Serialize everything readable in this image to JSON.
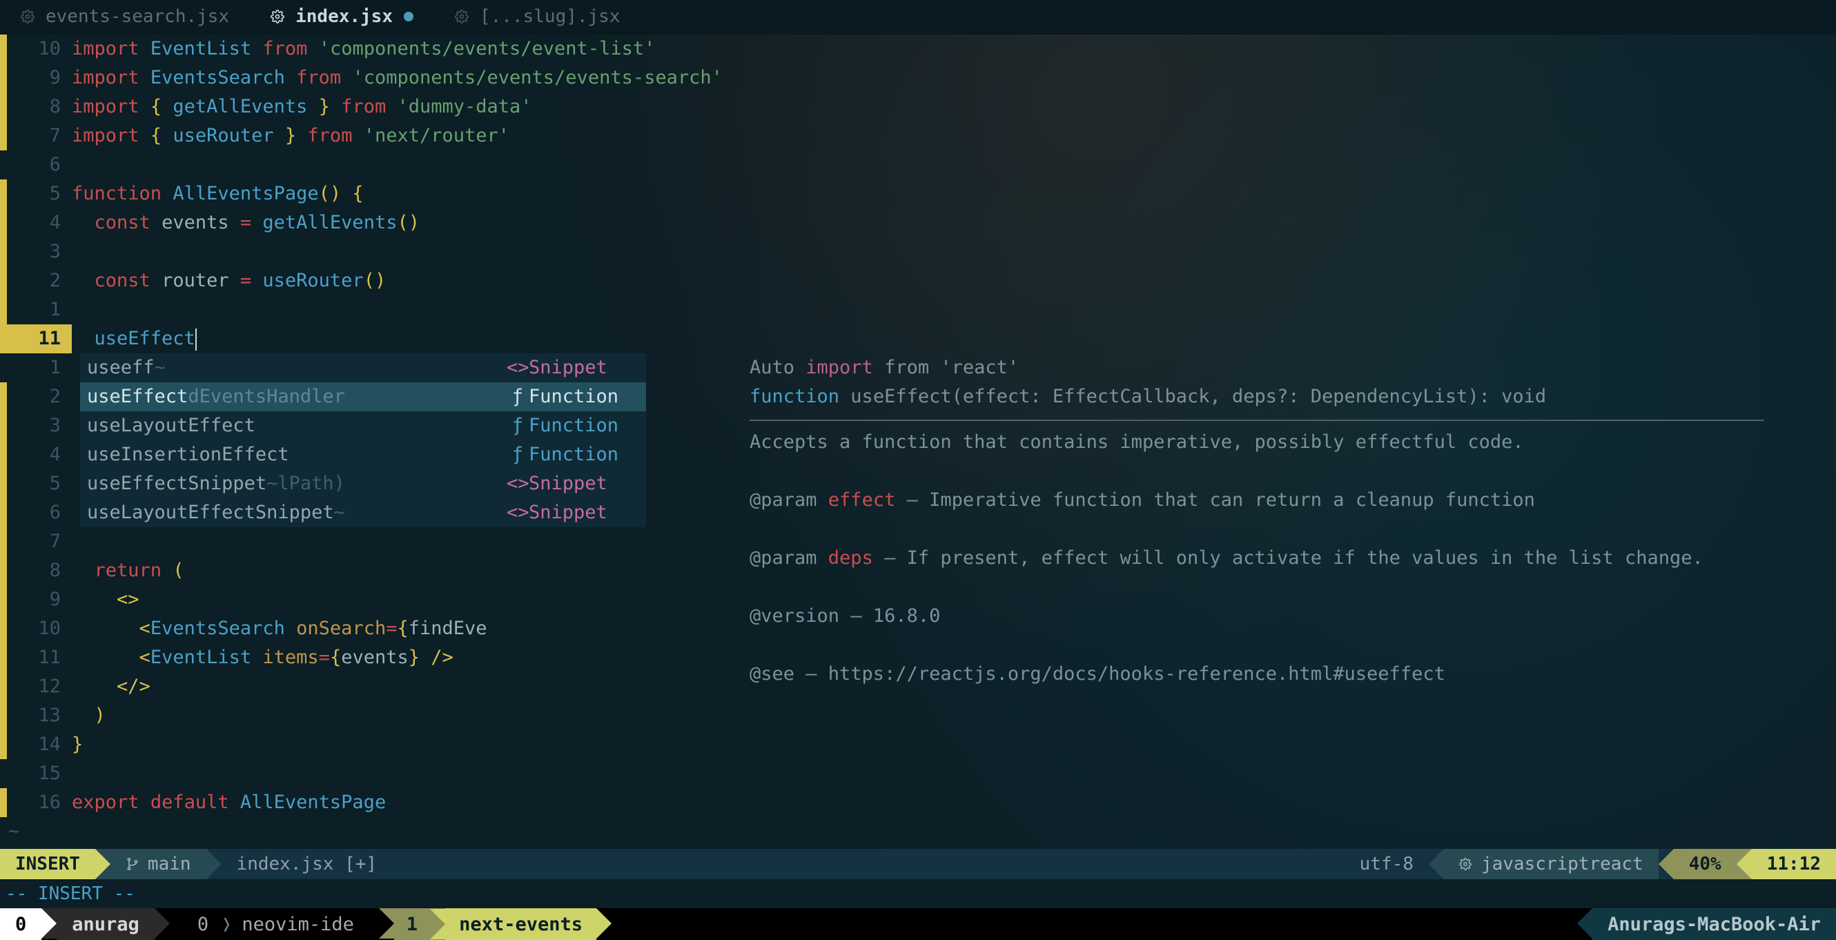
{
  "tabs": [
    {
      "name": "events-search.jsx",
      "active": false,
      "modified": false
    },
    {
      "name": "index.jsx",
      "active": true,
      "modified": true
    },
    {
      "name": "[...slug].jsx",
      "active": false,
      "modified": false
    }
  ],
  "code": {
    "lines": [
      {
        "n": "10",
        "rel": true,
        "border": true,
        "tokens": [
          [
            "kw",
            "import"
          ],
          [
            "pl",
            " "
          ],
          [
            "ident",
            "EventList"
          ],
          [
            "pl",
            " "
          ],
          [
            "kw",
            "from"
          ],
          [
            "pl",
            " "
          ],
          [
            "str",
            "'components/events/event-list'"
          ]
        ]
      },
      {
        "n": "9",
        "rel": true,
        "border": true,
        "tokens": [
          [
            "kw",
            "import"
          ],
          [
            "pl",
            " "
          ],
          [
            "ident",
            "EventsSearch"
          ],
          [
            "pl",
            " "
          ],
          [
            "kw",
            "from"
          ],
          [
            "pl",
            " "
          ],
          [
            "str",
            "'components/events/events-search'"
          ]
        ]
      },
      {
        "n": "8",
        "rel": true,
        "border": true,
        "tokens": [
          [
            "kw",
            "import"
          ],
          [
            "pl",
            " "
          ],
          [
            "brace",
            "{ "
          ],
          [
            "ident",
            "getAllEvents"
          ],
          [
            "brace",
            " }"
          ],
          [
            "pl",
            " "
          ],
          [
            "kw",
            "from"
          ],
          [
            "pl",
            " "
          ],
          [
            "str",
            "'dummy-data'"
          ]
        ]
      },
      {
        "n": "7",
        "rel": true,
        "border": true,
        "tokens": [
          [
            "kw",
            "import"
          ],
          [
            "pl",
            " "
          ],
          [
            "brace",
            "{ "
          ],
          [
            "ident",
            "useRouter"
          ],
          [
            "brace",
            " }"
          ],
          [
            "pl",
            " "
          ],
          [
            "kw",
            "from"
          ],
          [
            "pl",
            " "
          ],
          [
            "str",
            "'next/router'"
          ]
        ]
      },
      {
        "n": "6",
        "rel": true,
        "border": false,
        "tokens": []
      },
      {
        "n": "5",
        "rel": true,
        "border": true,
        "tokens": [
          [
            "kw",
            "function"
          ],
          [
            "pl",
            " "
          ],
          [
            "ident",
            "AllEventsPage"
          ],
          [
            "brace",
            "()"
          ],
          [
            "pl",
            " "
          ],
          [
            "brace",
            "{"
          ]
        ]
      },
      {
        "n": "4",
        "rel": true,
        "border": true,
        "tokens": [
          [
            "pl",
            "  "
          ],
          [
            "kw",
            "const"
          ],
          [
            "pl",
            " "
          ],
          [
            "pl",
            "events "
          ],
          [
            "kw",
            "="
          ],
          [
            "pl",
            " "
          ],
          [
            "ident",
            "getAllEvents"
          ],
          [
            "brace",
            "()"
          ]
        ]
      },
      {
        "n": "3",
        "rel": true,
        "border": true,
        "tokens": []
      },
      {
        "n": "2",
        "rel": true,
        "border": true,
        "tokens": [
          [
            "pl",
            "  "
          ],
          [
            "kw",
            "const"
          ],
          [
            "pl",
            " "
          ],
          [
            "pl",
            "router "
          ],
          [
            "kw",
            "="
          ],
          [
            "pl",
            " "
          ],
          [
            "ident",
            "useRouter"
          ],
          [
            "brace",
            "()"
          ]
        ]
      },
      {
        "n": "1",
        "rel": true,
        "border": true,
        "tokens": []
      },
      {
        "n": "11",
        "rel": false,
        "border": true,
        "current": true,
        "tokens": [
          [
            "pl",
            "  "
          ],
          [
            "ident",
            "useEffect"
          ]
        ],
        "cursor": true
      },
      {
        "n": "1",
        "rel": true,
        "border": false,
        "completion_row": true
      },
      {
        "n": "2",
        "rel": true,
        "border": true,
        "completion_row": true
      },
      {
        "n": "3",
        "rel": true,
        "border": true,
        "completion_row": true
      },
      {
        "n": "4",
        "rel": true,
        "border": true,
        "completion_row": true
      },
      {
        "n": "5",
        "rel": true,
        "border": true,
        "completion_row": true
      },
      {
        "n": "6",
        "rel": true,
        "border": true,
        "completion_row": true
      },
      {
        "n": "7",
        "rel": true,
        "border": true,
        "tokens": []
      },
      {
        "n": "8",
        "rel": true,
        "border": true,
        "tokens": [
          [
            "pl",
            "  "
          ],
          [
            "kw",
            "return"
          ],
          [
            "pl",
            " "
          ],
          [
            "brace",
            "("
          ]
        ]
      },
      {
        "n": "9",
        "rel": true,
        "border": true,
        "tokens": [
          [
            "pl",
            "    "
          ],
          [
            "brace",
            "<>"
          ]
        ]
      },
      {
        "n": "10",
        "rel": true,
        "border": true,
        "tokens": [
          [
            "pl",
            "      "
          ],
          [
            "brace",
            "<"
          ],
          [
            "ident",
            "EventsSearch"
          ],
          [
            "pl",
            " "
          ],
          [
            "propk",
            "onSearch"
          ],
          [
            "kw",
            "="
          ],
          [
            "brace",
            "{"
          ],
          [
            "pl",
            "findEve"
          ]
        ]
      },
      {
        "n": "11",
        "rel": true,
        "border": true,
        "tokens": [
          [
            "pl",
            "      "
          ],
          [
            "brace",
            "<"
          ],
          [
            "ident",
            "EventList"
          ],
          [
            "pl",
            " "
          ],
          [
            "propk",
            "items"
          ],
          [
            "kw",
            "="
          ],
          [
            "brace",
            "{"
          ],
          [
            "pl",
            "events"
          ],
          [
            "brace",
            "}"
          ],
          [
            "pl",
            " "
          ],
          [
            "brace",
            "/>"
          ]
        ]
      },
      {
        "n": "12",
        "rel": true,
        "border": true,
        "tokens": [
          [
            "pl",
            "    "
          ],
          [
            "brace",
            "</>"
          ]
        ]
      },
      {
        "n": "13",
        "rel": true,
        "border": true,
        "tokens": [
          [
            "pl",
            "  "
          ],
          [
            "brace",
            ")"
          ]
        ]
      },
      {
        "n": "14",
        "rel": true,
        "border": true,
        "tokens": [
          [
            "brace",
            "}"
          ]
        ]
      },
      {
        "n": "15",
        "rel": true,
        "border": false,
        "tokens": []
      },
      {
        "n": "16",
        "rel": true,
        "border": true,
        "tokens": [
          [
            "kw",
            "export"
          ],
          [
            "pl",
            " "
          ],
          [
            "kw",
            "default"
          ],
          [
            "pl",
            " "
          ],
          [
            "ident",
            "AllEventsPage"
          ]
        ]
      }
    ],
    "end_tilde": "~"
  },
  "completion": {
    "items": [
      {
        "label": "useeff",
        "tilde": true,
        "ghost": "",
        "type_icon": "<>",
        "type_label": "Snippet",
        "kind": "snippet",
        "selected": false
      },
      {
        "label": "useEffect",
        "tilde": false,
        "ghost": "dEventsHandler",
        "type_icon": "ƒ",
        "type_label": "Function",
        "kind": "func",
        "selected": true
      },
      {
        "label": "useLayoutEffect",
        "tilde": false,
        "ghost": "",
        "type_icon": "ƒ",
        "type_label": "Function",
        "kind": "func",
        "selected": false
      },
      {
        "label": "useInsertionEffect",
        "tilde": false,
        "ghost": "",
        "type_icon": "ƒ",
        "type_label": "Function",
        "kind": "func",
        "selected": false
      },
      {
        "label": "useEffectSnippet",
        "tilde": true,
        "ghost": "lPath)",
        "type_icon": "<>",
        "type_label": "Snippet",
        "kind": "snippet",
        "selected": false
      },
      {
        "label": "useLayoutEffectSnippet",
        "tilde": true,
        "ghost": "",
        "type_icon": "<>",
        "type_label": "Snippet",
        "kind": "snippet",
        "selected": false
      }
    ]
  },
  "doc": {
    "intro_prefix": "Auto ",
    "intro_kw": "import",
    "intro_suffix": " from 'react'",
    "sig_kw": "function",
    "sig_rest": " useEffect(effect: EffectCallback, deps?: DependencyList): void",
    "desc": "Accepts a function that contains imperative, possibly effectful code.",
    "param1_tag": "@param",
    "param1_name": "effect",
    "param1_text": " — Imperative function that can return a cleanup function",
    "param2_tag": "@param",
    "param2_name": "deps",
    "param2_text": " — If present, effect will only activate if the values in the list change.",
    "version": "@version — 16.8.0",
    "see": "@see — https://reactjs.org/docs/hooks-reference.html#useeffect"
  },
  "status": {
    "mode": "INSERT",
    "branch": "main",
    "file": "index.jsx [+]",
    "encoding": "utf-8",
    "filetype": "javascriptreact",
    "percent": "40%",
    "pos": "11:12"
  },
  "mode_echo": "-- INSERT --",
  "tmux": {
    "session_index": "0",
    "session_name": "anurag",
    "windows": [
      {
        "index": "0",
        "name": "neovim-ide",
        "active": false
      },
      {
        "index": "1",
        "name": "next-events",
        "active": true
      }
    ],
    "host": "Anurags-MacBook-Air"
  }
}
